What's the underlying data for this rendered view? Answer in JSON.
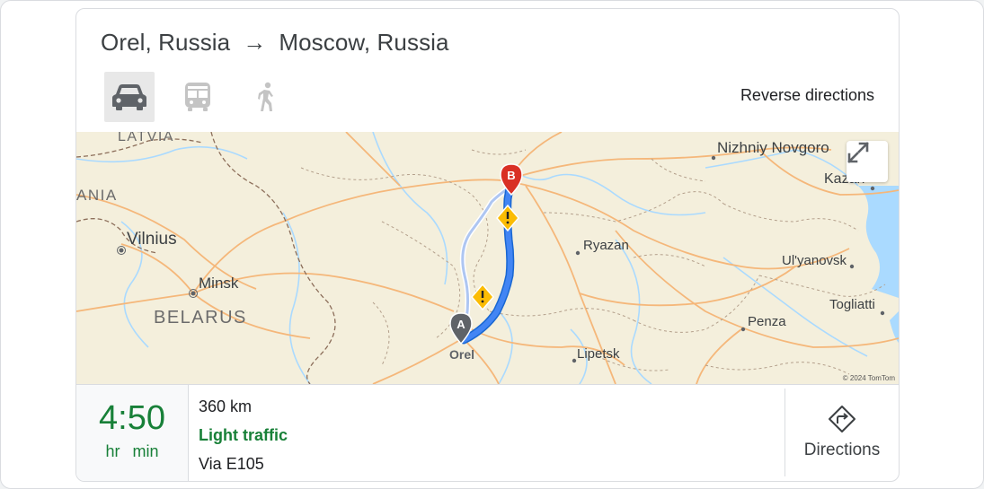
{
  "header": {
    "origin": "Orel, Russia",
    "arrow": "→",
    "destination": "Moscow, Russia",
    "reverse_label": "Reverse directions"
  },
  "modes": [
    {
      "name": "driving",
      "icon": "car-icon",
      "active": true
    },
    {
      "name": "transit",
      "icon": "bus-icon",
      "active": false
    },
    {
      "name": "walking",
      "icon": "walking-person-icon",
      "active": false
    }
  ],
  "map": {
    "labels": {
      "latvia": "LATVIA",
      "lithuania_partial": "ANIA",
      "vilnius": "Vilnius",
      "minsk": "Minsk",
      "belarus": "BELARUS",
      "orel": "Orel",
      "ryazan": "Ryazan",
      "lipetsk": "Lipetsk",
      "penza": "Penza",
      "ulyanovsk": "Ul'yanovsk",
      "togliatti": "Togliatti",
      "nizhniy": "Nizhniy Novgoro",
      "kazan": "Kazan"
    },
    "marker_start": "A",
    "marker_end": "B",
    "copyright": "© 2024 TomTom",
    "colors": {
      "route": "#4285f4",
      "marker_a": "#5f6368",
      "marker_b": "#d93025",
      "warning": "#fbbc04"
    }
  },
  "summary": {
    "time": "4:50",
    "hr": "hr",
    "min": "min",
    "distance": "360 km",
    "traffic": "Light traffic",
    "via": "Via E105",
    "directions_label": "Directions",
    "traffic_color": "#188038"
  }
}
